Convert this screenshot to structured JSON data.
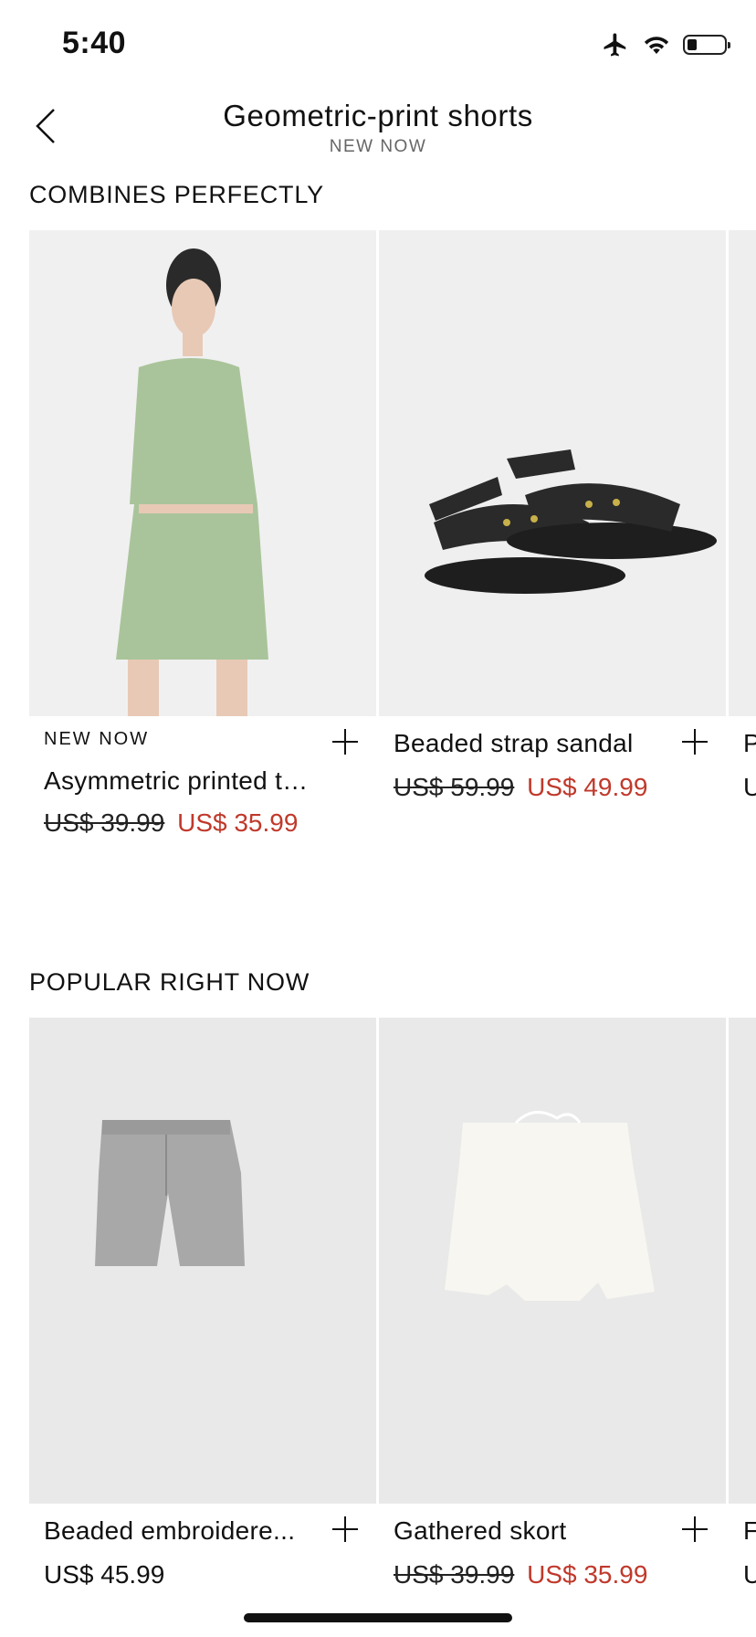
{
  "status": {
    "time": "5:40"
  },
  "header": {
    "title": "Geometric-print shorts",
    "subtitle": "NEW NOW"
  },
  "sections": [
    {
      "title": "COMBINES PERFECTLY",
      "products": [
        {
          "tag": "NEW NOW",
          "name": "Asymmetric printed top",
          "old_price": "US$ 39.99",
          "price": "US$ 35.99"
        },
        {
          "name": "Beaded strap sandal",
          "old_price": "US$ 59.99",
          "price": "US$ 49.99"
        },
        {
          "name": "P",
          "price": "U"
        }
      ]
    },
    {
      "title": "POPULAR RIGHT NOW",
      "products": [
        {
          "name": "Beaded embroidere...",
          "price": "US$ 45.99"
        },
        {
          "name": "Gathered skort",
          "old_price": "US$ 39.99",
          "price": "US$ 35.99"
        },
        {
          "name": "F",
          "price": "U"
        }
      ]
    }
  ],
  "colors": {
    "sale": "#c0392b",
    "image_bg": "#ececec"
  }
}
